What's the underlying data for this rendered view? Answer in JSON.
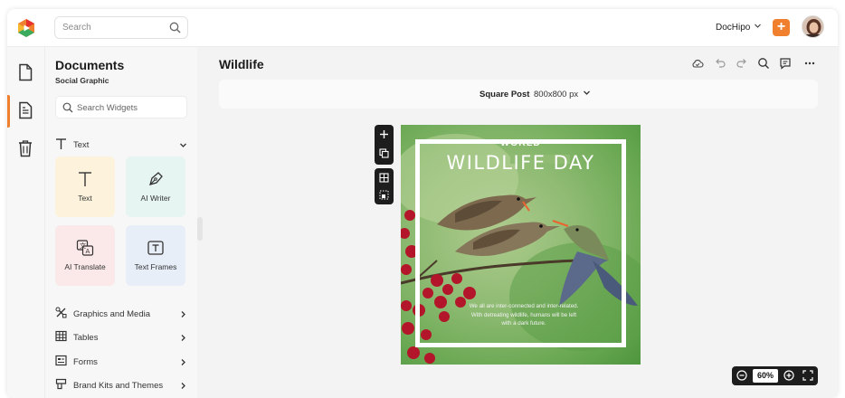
{
  "topbar": {
    "search_placeholder": "Search",
    "brand": "DocHipo",
    "plus_label": "+"
  },
  "rail": {
    "items": [
      {
        "icon": "document-icon"
      },
      {
        "icon": "document-list-icon",
        "active": true
      },
      {
        "icon": "trash-icon"
      }
    ]
  },
  "sidebar": {
    "title": "Documents",
    "subtitle": "Social Graphic",
    "search_placeholder": "Search Widgets",
    "text_section": "Text",
    "tiles": [
      {
        "label": "Text",
        "bg": "#fdf3dc"
      },
      {
        "label": "AI Writer",
        "bg": "#e6f4f2"
      },
      {
        "label": "AI Translate",
        "bg": "#fbe9e9"
      },
      {
        "label": "Text Frames",
        "bg": "#e7eef8"
      }
    ],
    "sections": [
      "Graphics and Media",
      "Tables",
      "Forms",
      "Brand Kits and Themes"
    ]
  },
  "main": {
    "title": "Wildlife",
    "size_name": "Square Post",
    "size_dims": "800x800 px",
    "zoom": "60%"
  },
  "design": {
    "kicker": "WORLD",
    "headline": "WILDLIFE DAY",
    "caption_lines": [
      "We all are inter-connected and inter-related.",
      "With detreating wildlife, humans will be left",
      "with a dark future."
    ]
  },
  "colors": {
    "accent": "#f0802d",
    "dark_toolbar": "#1d1d1d"
  }
}
